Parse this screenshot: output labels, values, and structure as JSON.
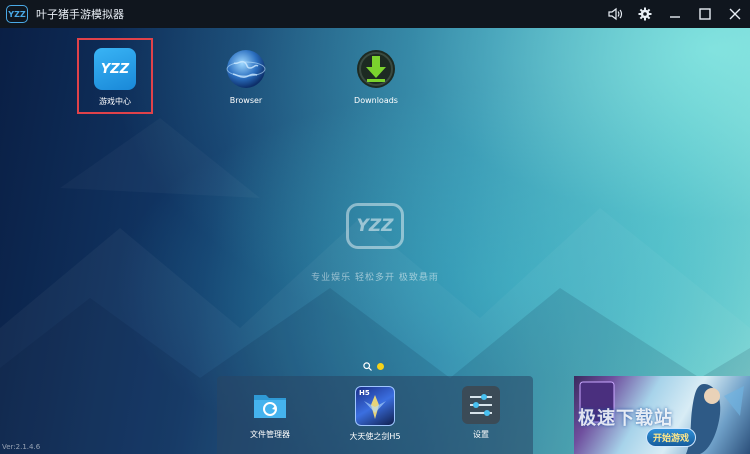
{
  "window": {
    "logo_text": "YZZ",
    "title": "叶子猪手游模拟器"
  },
  "window_controls": [
    "speaker-icon",
    "gear-icon",
    "minimize-icon",
    "maximize-icon",
    "close-icon"
  ],
  "desktop": {
    "icons": [
      {
        "label": "游戏中心",
        "icon": "yzz-game-center-icon",
        "selected": true
      },
      {
        "label": "Browser",
        "icon": "globe-icon"
      },
      {
        "label": "Downloads",
        "icon": "download-icon"
      }
    ],
    "center_logo": "YZZ",
    "slogan": "专业娱乐  轻松多开  极致悬雨",
    "pager": {
      "pages": 1,
      "current": 1
    }
  },
  "dock": [
    {
      "label": "文件管理器",
      "icon": "folder-icon"
    },
    {
      "label": "大天使之剑H5",
      "icon": "game-app-icon",
      "badge": "H5"
    },
    {
      "label": "设置",
      "icon": "settings-icon"
    }
  ],
  "version": "Ver:2.1.4.6",
  "ad": {
    "button": "开始游戏",
    "watermark": "极速下载站"
  },
  "colors": {
    "titlebar": "#10161e",
    "selection": "#e0424a",
    "accent": "#39b4f5",
    "pager_dot": "#f4d21a"
  }
}
